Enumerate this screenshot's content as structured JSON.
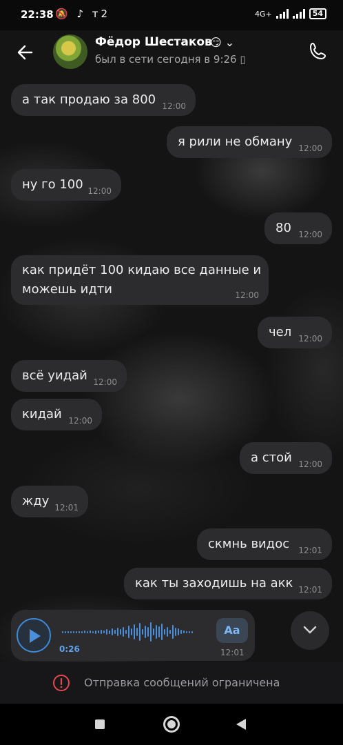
{
  "status_bar": {
    "time": "22:38",
    "icons": "🔕 ♪ т2",
    "network": "4G+",
    "battery": "54"
  },
  "header": {
    "name": "Фёдор Шестаков",
    "name_icons": "😏 ⌄",
    "last_seen": "был в сети сегодня в 9:26 ▯"
  },
  "messages": [
    {
      "text": "а так продаю за 800",
      "time": "12:00",
      "side": "in"
    },
    {
      "text": "я рили не обману",
      "time": "12:00",
      "side": "out"
    },
    {
      "text": "ну го 100",
      "time": "12:00",
      "side": "in"
    },
    {
      "text": "80",
      "time": "12:00",
      "side": "out"
    },
    {
      "text_line1": "как придёт 100 кидаю все данные и",
      "text_line2": "можешь идти",
      "time": "12:00",
      "side": "in"
    },
    {
      "text": "чел",
      "time": "12:00",
      "side": "out"
    },
    {
      "text": "всё уидай",
      "time": "12:00",
      "side": "in"
    },
    {
      "text": "кидай",
      "time": "12:00",
      "side": "in"
    },
    {
      "text": "а стой",
      "time": "12:00",
      "side": "out"
    },
    {
      "text": "жду",
      "time": "12:01",
      "side": "in"
    },
    {
      "text": "скмнь видос",
      "time": "12:01",
      "side": "out"
    },
    {
      "text": "как ты заходишь на акк",
      "time": "12:01",
      "side": "out"
    }
  ],
  "voice_message": {
    "duration": "0:26",
    "transcribe_label": "Aa",
    "time": "12:01"
  },
  "restriction": {
    "text": "Отправка сообщений ограничена",
    "icon": "warning-circle-icon"
  },
  "colors": {
    "bubble": "#2c2c2e",
    "accent": "#4a8fdc",
    "warning": "#e5484d"
  }
}
